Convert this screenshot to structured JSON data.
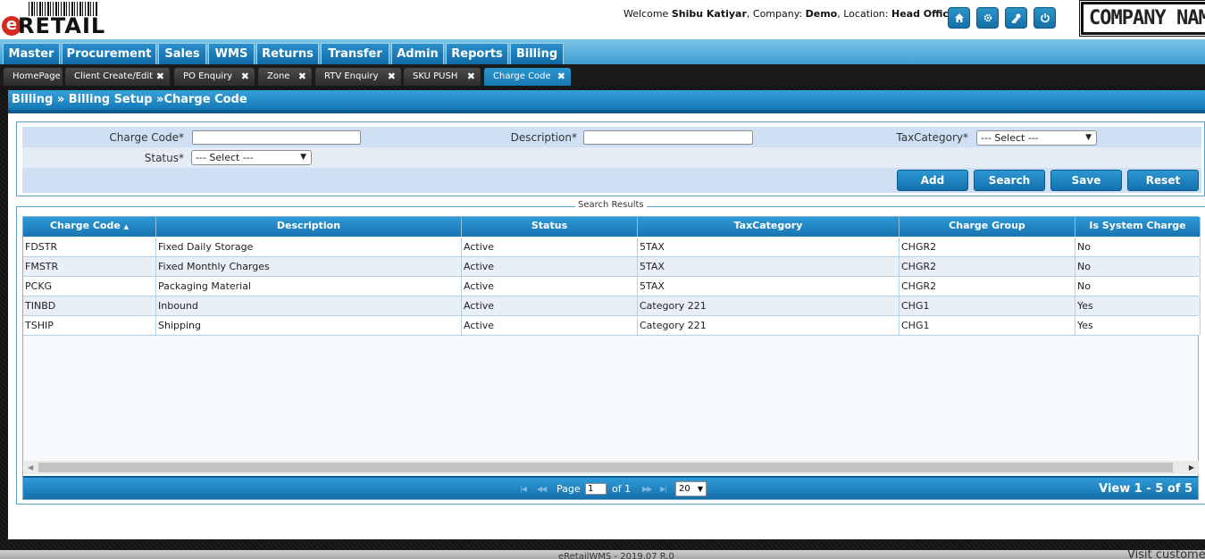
{
  "header": {
    "logo_text": "RETAIL",
    "logo_letter": "e",
    "welcome_prefix": "Welcome",
    "user_name": "Shibu Katiyar",
    "company_label": ", Company:",
    "company_value": "Demo",
    "location_label": ", Location:",
    "location_value": "Head Office",
    "company_logo_text": "COMPANY NAME",
    "icons": [
      "home-icon",
      "gear-icon",
      "key-icon",
      "power-icon"
    ]
  },
  "menu": {
    "items": [
      {
        "label": "Master"
      },
      {
        "label": "Procurement"
      },
      {
        "label": "Sales"
      },
      {
        "label": "WMS"
      },
      {
        "label": "Returns"
      },
      {
        "label": "Transfer"
      },
      {
        "label": "Admin"
      },
      {
        "label": "Reports"
      },
      {
        "label": "Billing"
      }
    ]
  },
  "tabs": {
    "items": [
      {
        "label": "HomePage",
        "closable": false
      },
      {
        "label": "Client Create/Edit",
        "closable": true
      },
      {
        "label": "PO Enquiry",
        "closable": true
      },
      {
        "label": "Zone",
        "closable": true
      },
      {
        "label": "RTV Enquiry",
        "closable": true
      },
      {
        "label": "SKU PUSH",
        "closable": true
      },
      {
        "label": "Charge Code",
        "closable": true,
        "active": true
      }
    ],
    "close_glyph": "✖"
  },
  "breadcrumb": "Billing » Billing Setup »Charge Code",
  "filter": {
    "charge_code_label": "Charge Code*",
    "charge_code_value": "",
    "description_label": "Description*",
    "description_value": "",
    "tax_category_label": "TaxCategory*",
    "tax_category_value": "--- Select ---",
    "status_label": "Status*",
    "status_value": "--- Select ---",
    "buttons": {
      "add": "Add",
      "search": "Search",
      "save": "Save",
      "reset": "Reset"
    }
  },
  "results": {
    "legend": "Search Results",
    "columns": [
      "Charge Code",
      "Description",
      "Status",
      "TaxCategory",
      "Charge Group",
      "Is System Charge"
    ],
    "sort_glyph": "▲▼",
    "rows": [
      [
        "FDSTR",
        "Fixed Daily Storage",
        "Active",
        "5TAX",
        "CHGR2",
        "No"
      ],
      [
        "FMSTR",
        "Fixed Monthly Charges",
        "Active",
        "5TAX",
        "CHGR2",
        "No"
      ],
      [
        "PCKG",
        "Packaging Material",
        "Active",
        "5TAX",
        "CHGR2",
        "No"
      ],
      [
        "TINBD",
        "Inbound",
        "Active",
        "Category 221",
        "CHG1",
        "Yes"
      ],
      [
        "TSHIP",
        "Shipping",
        "Active",
        "Category 221",
        "CHG1",
        "Yes"
      ]
    ],
    "pager": {
      "page_label": "Page",
      "page_value": "1",
      "of_label": "of 1",
      "page_size": "20",
      "view_text": "View 1 - 5 of 5"
    }
  },
  "footer": {
    "version_text": "eRetailWMS - 2019.07 R.0",
    "right_text": "Visit customer"
  },
  "colors": {
    "accent": "#1878b2",
    "menu_bg": "#3d9ed3",
    "tab_active": "#2c96d0",
    "frame": "#161616"
  }
}
